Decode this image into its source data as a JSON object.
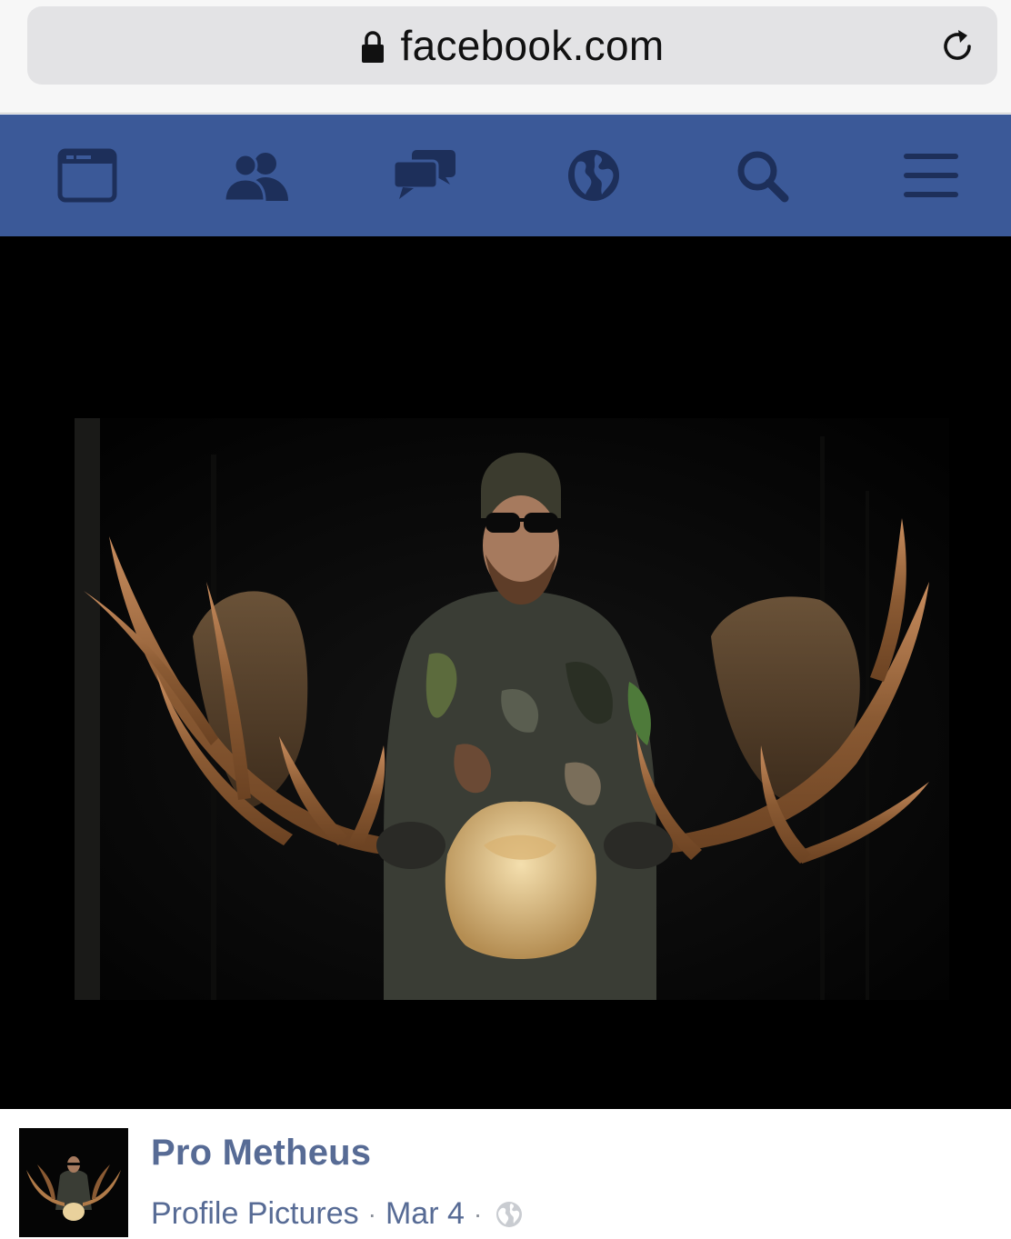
{
  "browser": {
    "url": "facebook.com",
    "lock_icon": "lock-icon",
    "reload_icon": "reload-icon"
  },
  "nav": {
    "background": "#3b5998",
    "icons": [
      "news-feed-icon",
      "friend-requests-icon",
      "messages-icon",
      "notifications-globe-icon",
      "search-icon",
      "menu-icon"
    ]
  },
  "post": {
    "author": "Pro Metheus",
    "album": "Profile Pictures",
    "date": "Mar 4",
    "separator": "·",
    "privacy_icon": "globe-icon",
    "link_color": "#576b95"
  }
}
